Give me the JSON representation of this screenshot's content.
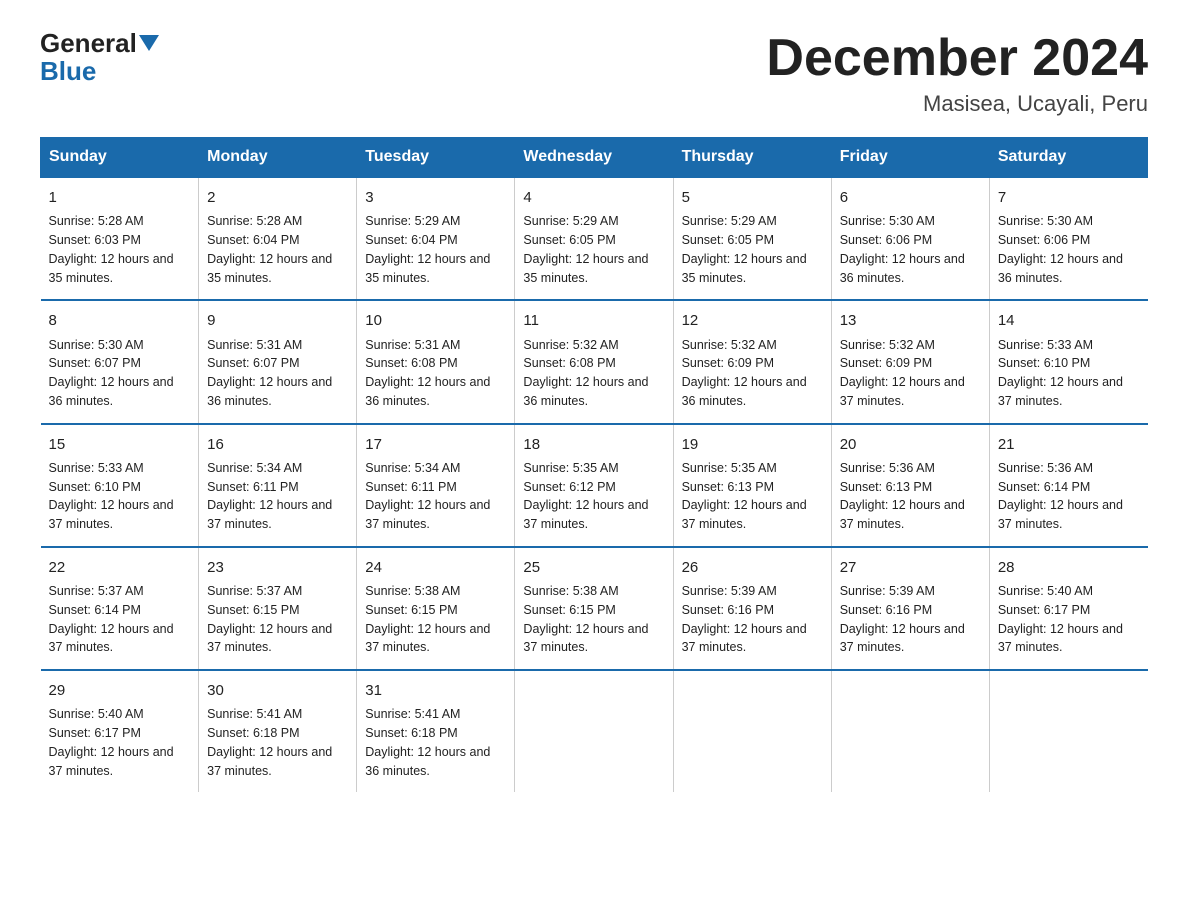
{
  "logo": {
    "general": "General",
    "blue": "Blue"
  },
  "title": {
    "month": "December 2024",
    "location": "Masisea, Ucayali, Peru"
  },
  "days_of_week": [
    "Sunday",
    "Monday",
    "Tuesday",
    "Wednesday",
    "Thursday",
    "Friday",
    "Saturday"
  ],
  "weeks": [
    [
      {
        "day": "1",
        "sunrise": "5:28 AM",
        "sunset": "6:03 PM",
        "daylight": "12 hours and 35 minutes."
      },
      {
        "day": "2",
        "sunrise": "5:28 AM",
        "sunset": "6:04 PM",
        "daylight": "12 hours and 35 minutes."
      },
      {
        "day": "3",
        "sunrise": "5:29 AM",
        "sunset": "6:04 PM",
        "daylight": "12 hours and 35 minutes."
      },
      {
        "day": "4",
        "sunrise": "5:29 AM",
        "sunset": "6:05 PM",
        "daylight": "12 hours and 35 minutes."
      },
      {
        "day": "5",
        "sunrise": "5:29 AM",
        "sunset": "6:05 PM",
        "daylight": "12 hours and 35 minutes."
      },
      {
        "day": "6",
        "sunrise": "5:30 AM",
        "sunset": "6:06 PM",
        "daylight": "12 hours and 36 minutes."
      },
      {
        "day": "7",
        "sunrise": "5:30 AM",
        "sunset": "6:06 PM",
        "daylight": "12 hours and 36 minutes."
      }
    ],
    [
      {
        "day": "8",
        "sunrise": "5:30 AM",
        "sunset": "6:07 PM",
        "daylight": "12 hours and 36 minutes."
      },
      {
        "day": "9",
        "sunrise": "5:31 AM",
        "sunset": "6:07 PM",
        "daylight": "12 hours and 36 minutes."
      },
      {
        "day": "10",
        "sunrise": "5:31 AM",
        "sunset": "6:08 PM",
        "daylight": "12 hours and 36 minutes."
      },
      {
        "day": "11",
        "sunrise": "5:32 AM",
        "sunset": "6:08 PM",
        "daylight": "12 hours and 36 minutes."
      },
      {
        "day": "12",
        "sunrise": "5:32 AM",
        "sunset": "6:09 PM",
        "daylight": "12 hours and 36 minutes."
      },
      {
        "day": "13",
        "sunrise": "5:32 AM",
        "sunset": "6:09 PM",
        "daylight": "12 hours and 37 minutes."
      },
      {
        "day": "14",
        "sunrise": "5:33 AM",
        "sunset": "6:10 PM",
        "daylight": "12 hours and 37 minutes."
      }
    ],
    [
      {
        "day": "15",
        "sunrise": "5:33 AM",
        "sunset": "6:10 PM",
        "daylight": "12 hours and 37 minutes."
      },
      {
        "day": "16",
        "sunrise": "5:34 AM",
        "sunset": "6:11 PM",
        "daylight": "12 hours and 37 minutes."
      },
      {
        "day": "17",
        "sunrise": "5:34 AM",
        "sunset": "6:11 PM",
        "daylight": "12 hours and 37 minutes."
      },
      {
        "day": "18",
        "sunrise": "5:35 AM",
        "sunset": "6:12 PM",
        "daylight": "12 hours and 37 minutes."
      },
      {
        "day": "19",
        "sunrise": "5:35 AM",
        "sunset": "6:13 PM",
        "daylight": "12 hours and 37 minutes."
      },
      {
        "day": "20",
        "sunrise": "5:36 AM",
        "sunset": "6:13 PM",
        "daylight": "12 hours and 37 minutes."
      },
      {
        "day": "21",
        "sunrise": "5:36 AM",
        "sunset": "6:14 PM",
        "daylight": "12 hours and 37 minutes."
      }
    ],
    [
      {
        "day": "22",
        "sunrise": "5:37 AM",
        "sunset": "6:14 PM",
        "daylight": "12 hours and 37 minutes."
      },
      {
        "day": "23",
        "sunrise": "5:37 AM",
        "sunset": "6:15 PM",
        "daylight": "12 hours and 37 minutes."
      },
      {
        "day": "24",
        "sunrise": "5:38 AM",
        "sunset": "6:15 PM",
        "daylight": "12 hours and 37 minutes."
      },
      {
        "day": "25",
        "sunrise": "5:38 AM",
        "sunset": "6:15 PM",
        "daylight": "12 hours and 37 minutes."
      },
      {
        "day": "26",
        "sunrise": "5:39 AM",
        "sunset": "6:16 PM",
        "daylight": "12 hours and 37 minutes."
      },
      {
        "day": "27",
        "sunrise": "5:39 AM",
        "sunset": "6:16 PM",
        "daylight": "12 hours and 37 minutes."
      },
      {
        "day": "28",
        "sunrise": "5:40 AM",
        "sunset": "6:17 PM",
        "daylight": "12 hours and 37 minutes."
      }
    ],
    [
      {
        "day": "29",
        "sunrise": "5:40 AM",
        "sunset": "6:17 PM",
        "daylight": "12 hours and 37 minutes."
      },
      {
        "day": "30",
        "sunrise": "5:41 AM",
        "sunset": "6:18 PM",
        "daylight": "12 hours and 37 minutes."
      },
      {
        "day": "31",
        "sunrise": "5:41 AM",
        "sunset": "6:18 PM",
        "daylight": "12 hours and 36 minutes."
      },
      null,
      null,
      null,
      null
    ]
  ],
  "labels": {
    "sunrise": "Sunrise: ",
    "sunset": "Sunset: ",
    "daylight": "Daylight: "
  }
}
